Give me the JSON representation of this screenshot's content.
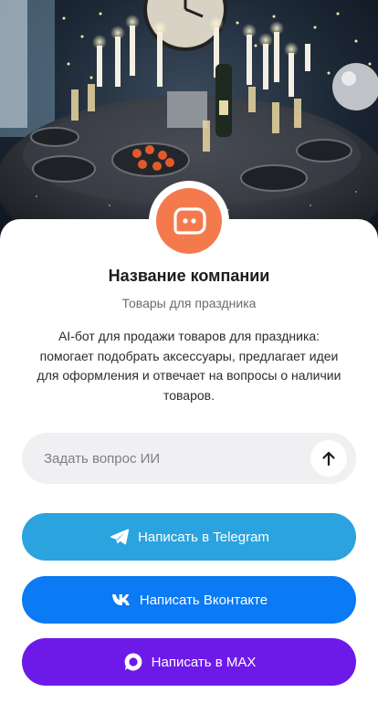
{
  "hero": {
    "image": "festive-table-photo"
  },
  "company": {
    "avatar_icon": "chat-bot-icon",
    "name": "Название компании",
    "subtitle": "Товары для праздника",
    "description": "AI-бот для продажи товаров для праздника: помогает подобрать аксессуары, предлагает идеи для оформления и отвечает на вопросы о наличии товаров."
  },
  "ask": {
    "placeholder": "Задать вопрос ИИ",
    "value": "",
    "send_icon": "arrow-up-icon"
  },
  "buttons": [
    {
      "label": "Написать в Telegram",
      "icon": "telegram-icon",
      "color": "#2aa3df"
    },
    {
      "label": "Написать Вконтакте",
      "icon": "vk-icon",
      "color": "#0a7af5"
    },
    {
      "label": "Написать в MAX",
      "icon": "max-icon",
      "color": "#6d1ae8"
    }
  ],
  "colors": {
    "accent": "#f47a4d",
    "input_bg": "#f0f0f2"
  }
}
